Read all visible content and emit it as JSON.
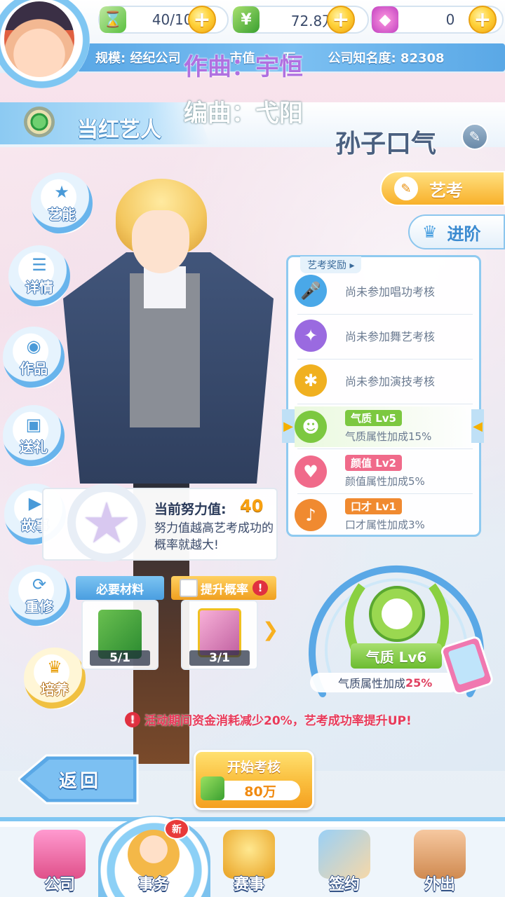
{
  "resources": {
    "energy": {
      "icon": "hourglass-lightning-icon",
      "value": "40/100"
    },
    "money": {
      "icon": "cash-stack-icon",
      "value": "72.8万"
    },
    "gems": {
      "icon": "pink-gem-icon",
      "value": "0"
    }
  },
  "info_bar": {
    "scale_text": "规模: 经纪公司",
    "mid_text": "市值",
    "mid_tail": "万",
    "fame_text": "公司知名度: 82308"
  },
  "overlay_lyrics": {
    "line1": "作曲：宇恒",
    "line2": "编曲：弋阳"
  },
  "title": {
    "label": "当红艺人",
    "character_name": "孙子口气"
  },
  "left_menu": [
    {
      "name": "talent",
      "label": "艺能",
      "icon": "star-icon"
    },
    {
      "name": "details",
      "label": "详情",
      "icon": "list-icon"
    },
    {
      "name": "works",
      "label": "作品",
      "icon": "disc-note-icon"
    },
    {
      "name": "gift",
      "label": "送礼",
      "icon": "gift-icon"
    },
    {
      "name": "story",
      "label": "故事",
      "icon": "play-screen-icon"
    },
    {
      "name": "retrain",
      "label": "重修",
      "icon": "refresh-star-icon"
    },
    {
      "name": "cultivate",
      "label": "培养",
      "icon": "crown-icon"
    }
  ],
  "right_actions": {
    "exam": {
      "label": "艺考",
      "icon": "exam-paper-icon"
    },
    "advance": {
      "label": "进阶",
      "icon": "crown-icon"
    }
  },
  "rewards_panel": {
    "tag": "艺考奖励 ▸",
    "rows": [
      {
        "icon": "microphone-icon",
        "text": "尚未参加唱功考核",
        "color": "#4aa8e8"
      },
      {
        "icon": "dance-icon",
        "text": "尚未参加舞艺考核",
        "color": "#9a6ae0"
      },
      {
        "icon": "clapper-icon",
        "text": "尚未参加演技考核",
        "color": "#f0b020"
      },
      {
        "icon": "frog-temperament-icon",
        "badge": "气质 Lv5",
        "desc": "气质属性加成15%",
        "color": "#7cc840"
      },
      {
        "icon": "lipstick-icon",
        "badge": "颜值 Lv2",
        "desc": "颜值属性加成5%",
        "color": "#f06a8a"
      },
      {
        "icon": "parrot-icon",
        "badge": "口才 Lv1",
        "desc": "口才属性加成3%",
        "color": "#f08a30"
      }
    ]
  },
  "effort": {
    "label": "当前努力值:",
    "value": "40",
    "desc": "努力值越高艺考成功的概率就越大!"
  },
  "materials": {
    "required_label": "必要材料",
    "required_count": "5/1",
    "boost_label": "提升概率",
    "boost_count": "3/1"
  },
  "current_badge": {
    "label": "气质 Lv6",
    "bonus_prefix": "气质属性加成",
    "bonus_value": "25%"
  },
  "event_tip": "活动期间资金消耗减少20%，艺考成功率提升UP!",
  "buttons": {
    "back": "返回",
    "start": "开始考核",
    "cost": "80万"
  },
  "bottom_nav": [
    {
      "name": "company",
      "label": "公司",
      "icon": "building-icon"
    },
    {
      "name": "affairs",
      "label": "事务",
      "icon": "manager-avatar-icon",
      "badge": "新"
    },
    {
      "name": "events",
      "label": "赛事",
      "icon": "trophy-icon"
    },
    {
      "name": "contract",
      "label": "签约",
      "icon": "handshake-icon"
    },
    {
      "name": "outing",
      "label": "外出",
      "icon": "door-icon"
    }
  ],
  "colors": {
    "accent_blue": "#5aa8e6",
    "gold": "#f8b02a",
    "warning": "#e83a5a"
  }
}
